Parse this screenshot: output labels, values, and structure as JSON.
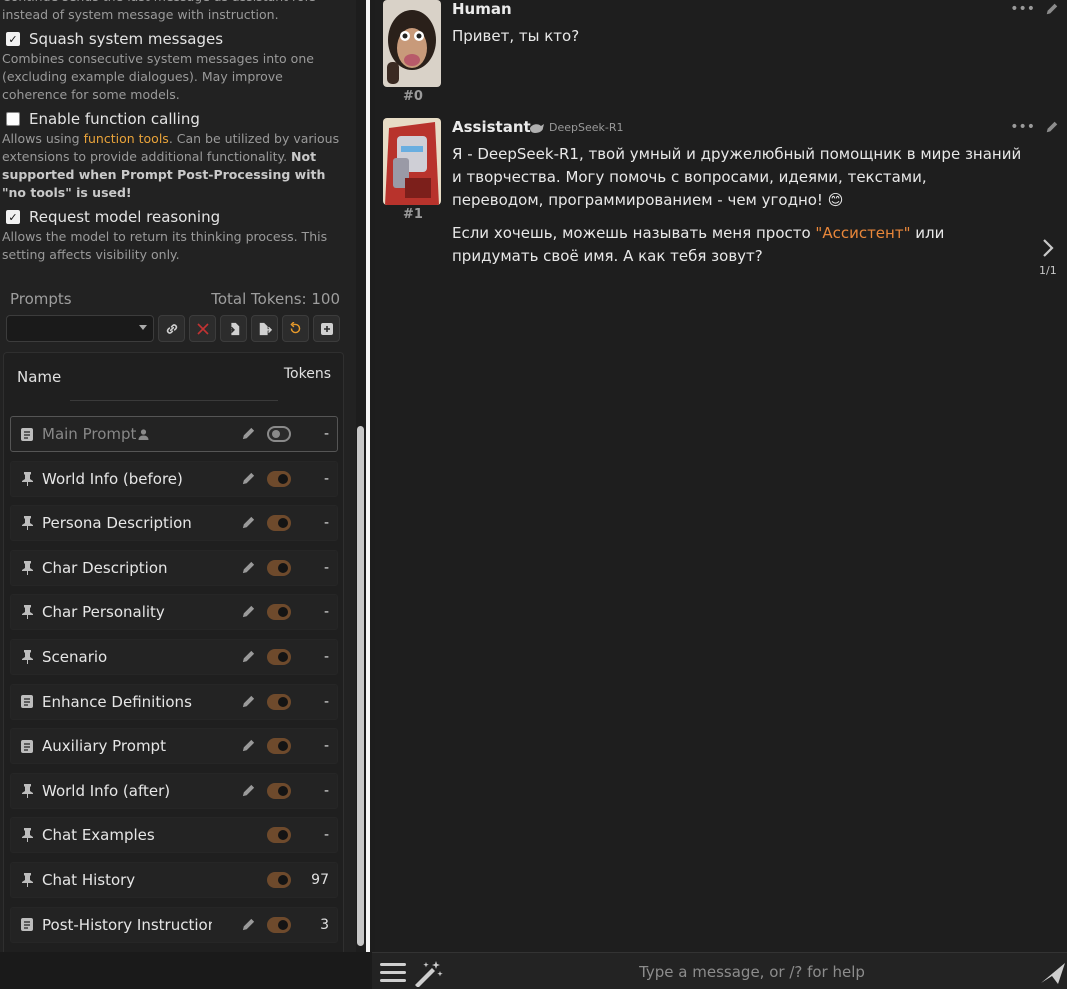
{
  "settings": {
    "truncated_desc": "Continue sends the last message as assistant role instead of system message with instruction.",
    "squash": {
      "label": "Squash system messages",
      "checked": true,
      "desc": "Combines consecutive system messages into one (excluding example dialogues). May improve coherence for some models."
    },
    "function_calling": {
      "label": "Enable function calling",
      "checked": false,
      "desc_a": "Allows using ",
      "desc_link": "function tools",
      "desc_b": ". Can be utilized by various extensions to provide additional functionality. ",
      "desc_bold": "Not supported when Prompt Post-Processing with \"no tools\" is used!"
    },
    "reasoning": {
      "label": "Request model reasoning",
      "checked": true,
      "desc": "Allows the model to return its thinking process. This setting affects visibility only."
    }
  },
  "prompts": {
    "title": "Prompts",
    "total_tokens": "Total Tokens: 100",
    "col_name": "Name",
    "col_tokens": "Tokens",
    "items": [
      {
        "label": "Main Prompt",
        "icon": "document-icon",
        "editable": true,
        "enabled": false,
        "tokens": "-",
        "person": true
      },
      {
        "label": "World Info (before)",
        "icon": "pin-icon",
        "editable": true,
        "enabled": true,
        "tokens": "-"
      },
      {
        "label": "Persona Description",
        "icon": "pin-icon",
        "editable": true,
        "enabled": true,
        "tokens": "-"
      },
      {
        "label": "Char Description",
        "icon": "pin-icon",
        "editable": true,
        "enabled": true,
        "tokens": "-"
      },
      {
        "label": "Char Personality",
        "icon": "pin-icon",
        "editable": true,
        "enabled": true,
        "tokens": "-"
      },
      {
        "label": "Scenario",
        "icon": "pin-icon",
        "editable": true,
        "enabled": true,
        "tokens": "-"
      },
      {
        "label": "Enhance Definitions",
        "icon": "document-icon",
        "editable": true,
        "enabled": true,
        "tokens": "-"
      },
      {
        "label": "Auxiliary Prompt",
        "icon": "document-icon",
        "editable": true,
        "enabled": true,
        "tokens": "-"
      },
      {
        "label": "World Info (after)",
        "icon": "pin-icon",
        "editable": true,
        "enabled": true,
        "tokens": "-"
      },
      {
        "label": "Chat Examples",
        "icon": "pin-icon",
        "editable": false,
        "enabled": true,
        "tokens": "-"
      },
      {
        "label": "Chat History",
        "icon": "pin-icon",
        "editable": false,
        "enabled": true,
        "tokens": "97"
      },
      {
        "label": "Post-History Instruction",
        "icon": "document-icon",
        "editable": true,
        "enabled": true,
        "tokens": "3"
      }
    ]
  },
  "chat": {
    "messages": [
      {
        "id": "#0",
        "name": "Human",
        "text": [
          "Привет, ты кто?"
        ]
      },
      {
        "id": "#1",
        "name": "Assistant",
        "model": "DeepSeek-R1",
        "p1": "Я - DeepSeek-R1, твой умный и дружелюбный помощник в мире знаний и творчества. Могу помочь с вопросами, идеями, текстами, переводом, программированием - чем угодно! 😊",
        "p2a": "Если хочешь, можешь называть меня просто ",
        "p2q": "\"Ассистент\"",
        "p2b": " или придумать своё имя. А как тебя зовут?",
        "swipe": "1/1"
      }
    ]
  },
  "input": {
    "placeholder": "Type a message, or /? for help"
  },
  "colors": {
    "accent": "#e9873a",
    "toggle_on": "#6e4a2c",
    "link": "#e9a33a"
  }
}
